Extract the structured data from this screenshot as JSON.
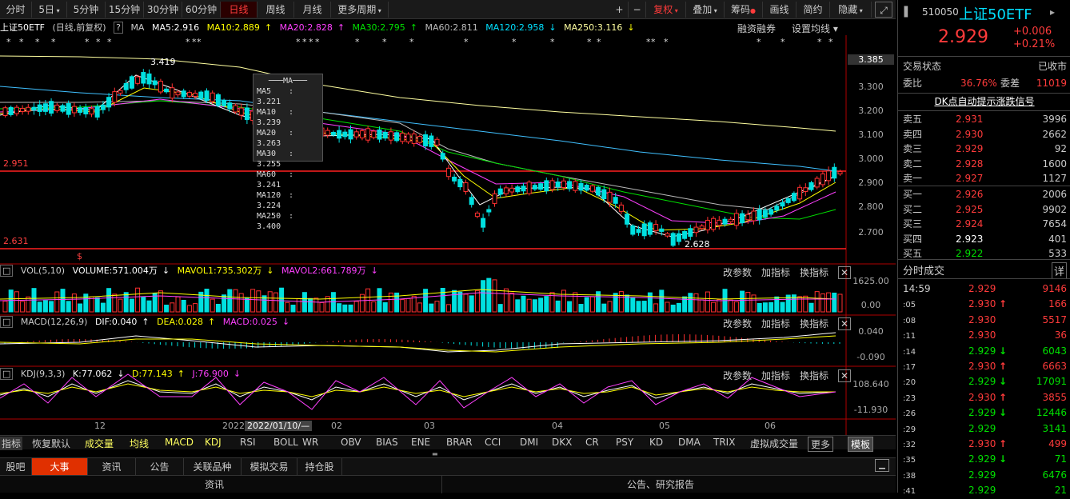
{
  "toolbar": {
    "items": [
      "分时",
      "5日",
      "5分钟",
      "15分钟",
      "30分钟",
      "60分钟",
      "日线",
      "周线",
      "月线",
      "更多周期"
    ],
    "right": [
      "+",
      "−",
      "复权",
      "叠加",
      "筹码",
      "画线",
      "简约",
      "隐藏"
    ]
  },
  "ma_line": {
    "name": "上证50ETF",
    "adjust": "(日线,前复权)",
    "label": "MA",
    "ma5": "MA5:2.916",
    "ma10": "MA10:2.889",
    "ma20": "MA20:2.828",
    "ma30": "MA30:2.795",
    "ma60": "MA60:2.811",
    "ma120": "MA120:2.958",
    "ma250": "MA250:3.116",
    "btn1": "融资融券",
    "btn2": "设置均线"
  },
  "price_axis": [
    "3.385",
    "3.300",
    "3.200",
    "3.100",
    "3.000",
    "2.900",
    "2.800",
    "2.700"
  ],
  "hlines": {
    "upper": "2.951",
    "lower": "2.631"
  },
  "annotations": {
    "high": "3.419",
    "low": "2.628"
  },
  "tooltip": {
    "title": "MA",
    "rows": [
      {
        "k": "MA5",
        "v": "3.221"
      },
      {
        "k": "MA10",
        "v": "3.239"
      },
      {
        "k": "MA20",
        "v": "3.263"
      },
      {
        "k": "MA30",
        "v": "3.255"
      },
      {
        "k": "MA60",
        "v": "3.241"
      },
      {
        "k": "MA120",
        "v": "3.224"
      },
      {
        "k": "MA250",
        "v": "3.400"
      }
    ]
  },
  "vol": {
    "label": "VOL(5,10)",
    "volume": "VOLUME:571.004万",
    "mavol1": "MAVOL1:735.302万",
    "mavol2": "MAVOL2:661.789万",
    "axis_top": "1625.00",
    "axis_bottom": "0.00"
  },
  "macd": {
    "label": "MACD(12,26,9)",
    "dif": "DIF:0.040",
    "dea": "DEA:0.028",
    "macd": "MACD:0.025",
    "axis_top": "0.040",
    "axis_bottom": "-0.090"
  },
  "kdj": {
    "label": "KDJ(9,3,3)",
    "k": "K:77.062",
    "d": "D:77.143",
    "j": "J:76.900",
    "axis_top": "108.640",
    "axis_bottom": "-11.930"
  },
  "panel_buttons": [
    "改参数",
    "加指标",
    "换指标"
  ],
  "x_axis": {
    "labels": [
      "12",
      "2022",
      "02",
      "03",
      "04",
      "05",
      "06"
    ],
    "cursor_date": "2022/01/10/—"
  },
  "indicator_tabs": [
    "指标",
    "恢复默认",
    "成交量",
    "均线",
    "MACD",
    "KDJ",
    "RSI",
    "BOLL",
    "WR",
    "OBV",
    "BIAS",
    "ENE",
    "BRAR",
    "CCI",
    "DMI",
    "DKX",
    "CR",
    "PSY",
    "KD",
    "DMA",
    "TRIX",
    "虚拟成交量",
    "更多",
    "模板"
  ],
  "info_tabs": [
    "股吧",
    "大事",
    "资讯",
    "公告",
    "关联品种",
    "模拟交易",
    "持仓股"
  ],
  "info_row": {
    "left": "资讯",
    "right": "公告、研究报告"
  },
  "side": {
    "code": "510050",
    "name": "上证50ETF",
    "price": "2.929",
    "change": "+0.006",
    "pct": "+0.21%",
    "status_label": "交易状态",
    "status": "已收市",
    "ratio_label": "委比",
    "ratio": "36.76%",
    "diff_label": "委差",
    "diff": "11019",
    "signal": "DK点自动提示涨跌信号",
    "asks": [
      {
        "name": "卖五",
        "price": "2.931",
        "vol": "3996"
      },
      {
        "name": "卖四",
        "price": "2.930",
        "vol": "2662"
      },
      {
        "name": "卖三",
        "price": "2.929",
        "vol": "92"
      },
      {
        "name": "卖二",
        "price": "2.928",
        "vol": "1600"
      },
      {
        "name": "卖一",
        "price": "2.927",
        "vol": "1127"
      }
    ],
    "bids": [
      {
        "name": "买一",
        "price": "2.926",
        "vol": "2006"
      },
      {
        "name": "买二",
        "price": "2.925",
        "vol": "9902"
      },
      {
        "name": "买三",
        "price": "2.924",
        "vol": "7654"
      },
      {
        "name": "买四",
        "price": "2.923",
        "vol": "401"
      },
      {
        "name": "买五",
        "price": "2.922",
        "vol": "533"
      }
    ],
    "ticks_title": "分时成交",
    "ticks_detail": "详",
    "ticks": [
      {
        "t": "14:59",
        "p": "2.929",
        "v": "9146",
        "c": "red",
        "arrow": ""
      },
      {
        "t": ":05",
        "p": "2.930",
        "v": "166",
        "c": "red",
        "arrow": "↑"
      },
      {
        "t": ":08",
        "p": "2.930",
        "v": "5517",
        "c": "red",
        "arrow": ""
      },
      {
        "t": ":11",
        "p": "2.930",
        "v": "36",
        "c": "red",
        "arrow": ""
      },
      {
        "t": ":14",
        "p": "2.929",
        "v": "6043",
        "c": "green",
        "arrow": "↓"
      },
      {
        "t": ":17",
        "p": "2.930",
        "v": "6663",
        "c": "red",
        "arrow": "↑"
      },
      {
        "t": ":20",
        "p": "2.929",
        "v": "17091",
        "c": "green",
        "arrow": "↓"
      },
      {
        "t": ":23",
        "p": "2.930",
        "v": "3855",
        "c": "red",
        "arrow": "↑"
      },
      {
        "t": ":26",
        "p": "2.929",
        "v": "12446",
        "c": "green",
        "arrow": "↓"
      },
      {
        "t": ":29",
        "p": "2.929",
        "v": "3141",
        "c": "green",
        "arrow": ""
      },
      {
        "t": ":32",
        "p": "2.930",
        "v": "499",
        "c": "red",
        "arrow": "↑"
      },
      {
        "t": ":35",
        "p": "2.929",
        "v": "71",
        "c": "green",
        "arrow": "↓"
      },
      {
        "t": ":38",
        "p": "2.929",
        "v": "6476",
        "c": "green",
        "arrow": ""
      },
      {
        "t": ":41",
        "p": "2.929",
        "v": "21",
        "c": "green",
        "arrow": ""
      }
    ]
  }
}
